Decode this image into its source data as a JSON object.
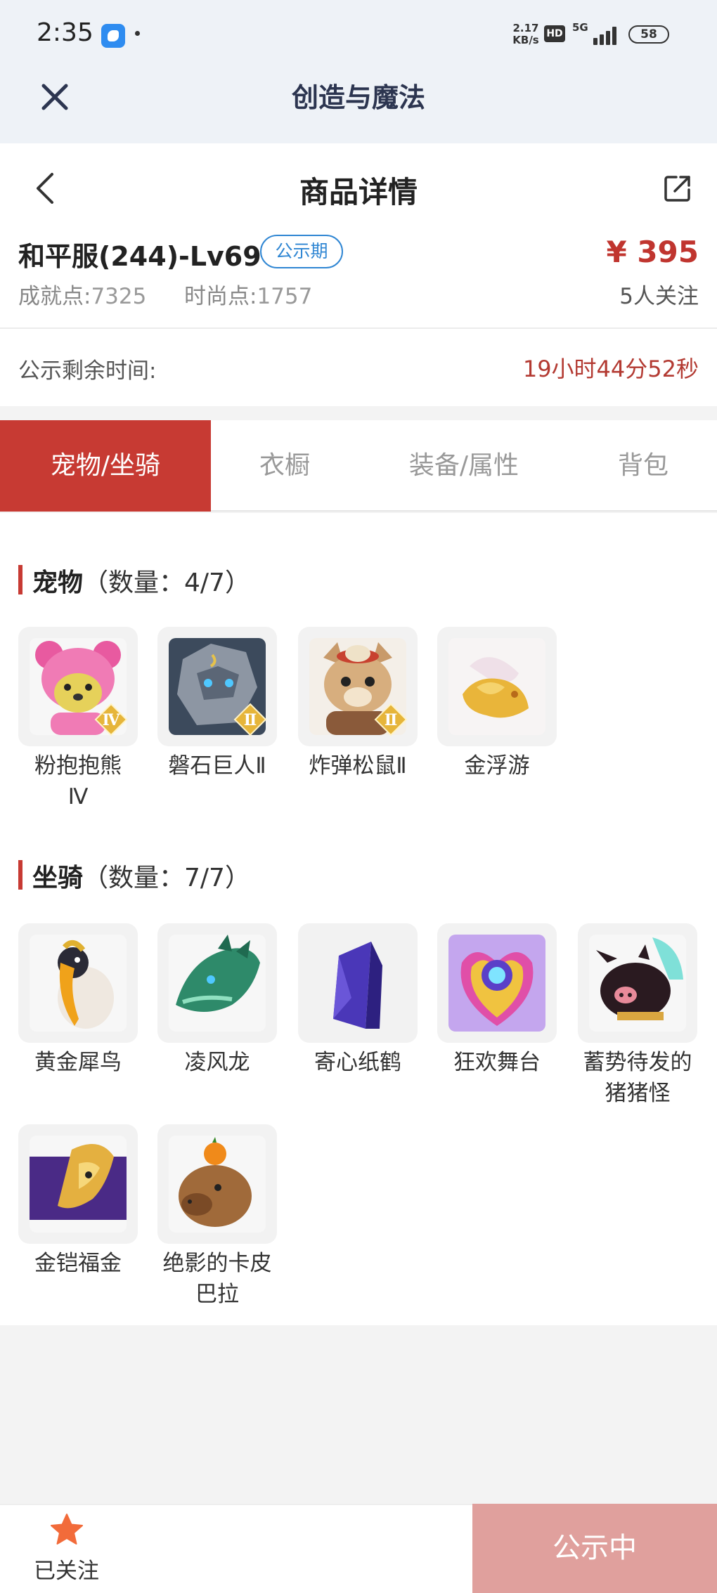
{
  "status_bar": {
    "time": "2:35",
    "net_speed_value": "2.17",
    "net_speed_unit": "KB/s",
    "hd": "HD",
    "network": "5G",
    "battery": "58"
  },
  "header": {
    "title": "创造与魔法",
    "page_title": "商品详情"
  },
  "product": {
    "name": "和平服(244)-Lv69",
    "status_chip": "公示期",
    "price": "¥ 395",
    "achievement_label": "成就点:",
    "achievement_value": "7325",
    "fashion_label": "时尚点:",
    "fashion_value": "1757",
    "followers": "5人关注",
    "countdown_label": "公示剩余时间:",
    "countdown_value": "19小时44分52秒"
  },
  "tabs": [
    {
      "label": "宠物/坐骑",
      "active": true
    },
    {
      "label": "衣橱",
      "active": false
    },
    {
      "label": "装备/属性",
      "active": false
    },
    {
      "label": "背包",
      "active": false
    }
  ],
  "pets": {
    "title": "宠物",
    "count": "（数量：4/7）",
    "items": [
      {
        "name": "粉抱抱熊\nⅣ",
        "tier": "Ⅳ"
      },
      {
        "name": "磐石巨人Ⅱ",
        "tier": "Ⅱ"
      },
      {
        "name": "炸弹松鼠Ⅱ",
        "tier": "Ⅱ"
      },
      {
        "name": "金浮游",
        "tier": ""
      }
    ]
  },
  "mounts": {
    "title": "坐骑",
    "count": "（数量：7/7）",
    "items": [
      {
        "name": "黄金犀鸟"
      },
      {
        "name": "凌风龙"
      },
      {
        "name": "寄心纸鹤"
      },
      {
        "name": "狂欢舞台"
      },
      {
        "name": "蓄势待发的\n猪猪怪"
      },
      {
        "name": "金铠福金"
      },
      {
        "name": "绝影的卡皮\n巴拉"
      }
    ]
  },
  "bottom_bar": {
    "follow_label": "已关注",
    "cta_label": "公示中"
  },
  "colors": {
    "accent": "#c73a33",
    "price": "#c0352f",
    "chip": "#2f86d3",
    "cta_disabled": "#e0a09d",
    "star": "#f26b3a"
  }
}
